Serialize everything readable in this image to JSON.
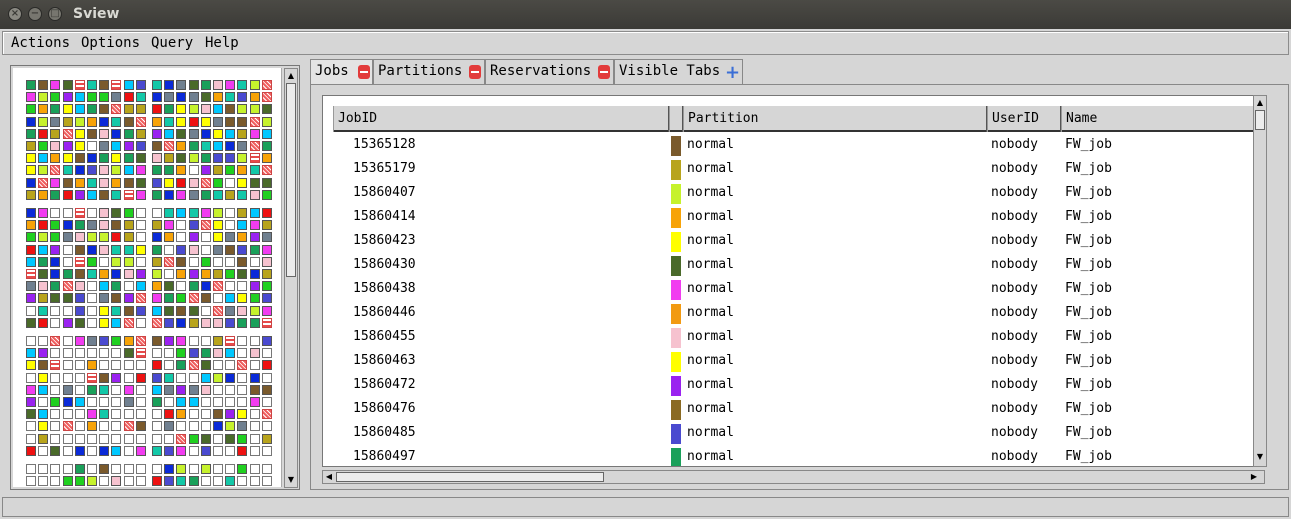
{
  "window": {
    "title": "Sview"
  },
  "menu": [
    "Actions",
    "Options",
    "Query",
    "Help"
  ],
  "tabs": [
    {
      "label": "Jobs",
      "closable": true
    },
    {
      "label": "Partitions",
      "closable": true
    },
    {
      "label": "Reservations",
      "closable": true
    },
    {
      "label": "Visible Tabs",
      "add": true
    }
  ],
  "table": {
    "columns": [
      "JobID",
      "Partition",
      "UserID",
      "Name"
    ],
    "rows": [
      {
        "jobid": "15365128",
        "partition": "normal",
        "userid": "nobody",
        "name": "FW_job",
        "color": "#7a5a2c"
      },
      {
        "jobid": "15365179",
        "partition": "normal",
        "userid": "nobody",
        "name": "FW_job",
        "color": "#b8a41c"
      },
      {
        "jobid": "15860407",
        "partition": "normal",
        "userid": "nobody",
        "name": "FW_job",
        "color": "#c6f22c"
      },
      {
        "jobid": "15860414",
        "partition": "normal",
        "userid": "nobody",
        "name": "FW_job",
        "color": "#f7a308"
      },
      {
        "jobid": "15860423",
        "partition": "normal",
        "userid": "nobody",
        "name": "FW_job",
        "color": "#ffff00"
      },
      {
        "jobid": "15860430",
        "partition": "normal",
        "userid": "nobody",
        "name": "FW_job",
        "color": "#4a6a2a"
      },
      {
        "jobid": "15860438",
        "partition": "normal",
        "userid": "nobody",
        "name": "FW_job",
        "color": "#f13cf0"
      },
      {
        "jobid": "15860446",
        "partition": "normal",
        "userid": "nobody",
        "name": "FW_job",
        "color": "#f29a12"
      },
      {
        "jobid": "15860455",
        "partition": "normal",
        "userid": "nobody",
        "name": "FW_job",
        "color": "#f6c2cf"
      },
      {
        "jobid": "15860463",
        "partition": "normal",
        "userid": "nobody",
        "name": "FW_job",
        "color": "#ffff00"
      },
      {
        "jobid": "15860472",
        "partition": "normal",
        "userid": "nobody",
        "name": "FW_job",
        "color": "#9a22f0"
      },
      {
        "jobid": "15860476",
        "partition": "normal",
        "userid": "nobody",
        "name": "FW_job",
        "color": "#8a6a22"
      },
      {
        "jobid": "15860485",
        "partition": "normal",
        "userid": "nobody",
        "name": "FW_job",
        "color": "#4a4ad0"
      },
      {
        "jobid": "15860497",
        "partition": "normal",
        "userid": "nobody",
        "name": "FW_job",
        "color": "#1aa05a"
      }
    ]
  },
  "node_palette": [
    "#f7a308",
    "#1aa05a",
    "#00c8ff",
    "#4a4ad0",
    "#9a22f0",
    "#ffff00",
    "#ee1111",
    "#c6f22c",
    "#7a5a2c",
    "#708090",
    "#f13cf0",
    "#13c8a8",
    "#b8a41c",
    "#4a6a2a",
    "#20d020",
    "#f6c2cf",
    "#0a2ad8"
  ]
}
